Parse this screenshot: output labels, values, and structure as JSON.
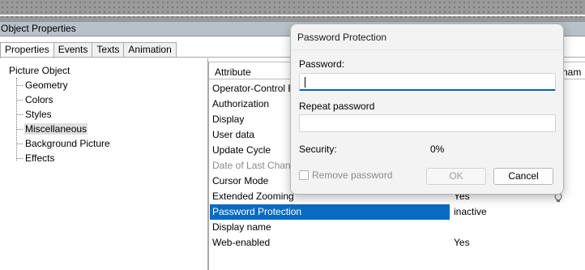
{
  "window": {
    "title": "Object Properties"
  },
  "tabs": [
    "Properties",
    "Events",
    "Texts",
    "Animation"
  ],
  "tree": {
    "root": "Picture Object",
    "items": [
      "Geometry",
      "Colors",
      "Styles",
      "Miscellaneous",
      "Background Picture",
      "Effects"
    ],
    "selected": "Miscellaneous"
  },
  "grid": {
    "header_attribute": "Attribute",
    "header_dynamic_partial": "ynam",
    "rows": [
      {
        "attribute": "Operator-Control E",
        "value": ""
      },
      {
        "attribute": "Authorization",
        "value": ""
      },
      {
        "attribute": "Display",
        "value": ""
      },
      {
        "attribute": "User data",
        "value": ""
      },
      {
        "attribute": "Update Cycle",
        "value": ""
      },
      {
        "attribute": "Date of Last Chang",
        "value": ""
      },
      {
        "attribute": "Cursor Mode",
        "value": ""
      },
      {
        "attribute": "Extended Zooming",
        "value": "Yes"
      },
      {
        "attribute": "Password Protection",
        "value": "inactive"
      },
      {
        "attribute": "Display name",
        "value": ""
      },
      {
        "attribute": "Web-enabled",
        "value": "Yes"
      }
    ],
    "selected_row": "Password Protection"
  },
  "dialog": {
    "title": "Password Protection",
    "password_label": "Password:",
    "password_value": "",
    "repeat_label": "Repeat password",
    "repeat_value": "",
    "security_label": "Security:",
    "security_value": "0%",
    "remove_password_label": "Remove password",
    "remove_password_checked": false,
    "ok_label": "OK",
    "cancel_label": "Cancel"
  },
  "colors": {
    "selection": "#0a6ac2",
    "focus_underline": "#0a5fbf",
    "titlebar": "#b8c0c8"
  },
  "icons": {
    "bulb": "lightbulb-icon"
  }
}
